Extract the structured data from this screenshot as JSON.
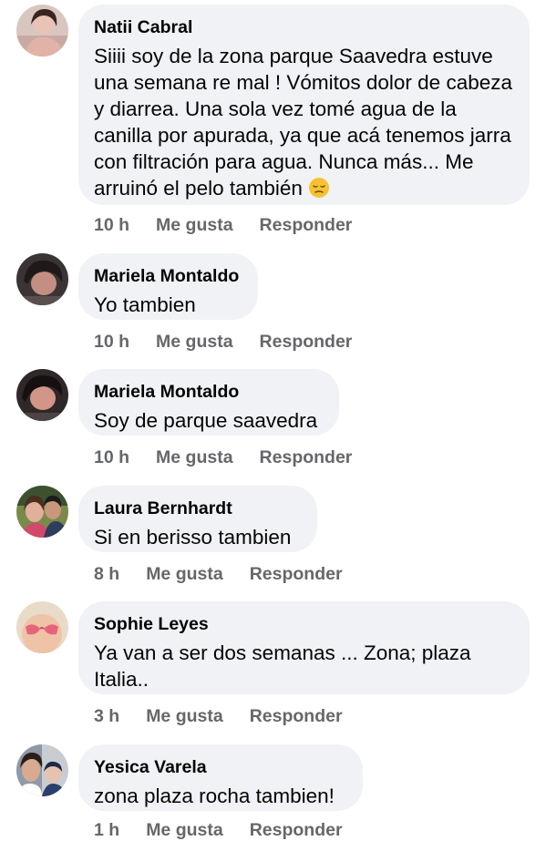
{
  "comments": [
    {
      "author": "Natii Cabral",
      "text": "Siiii soy de la zona parque Saavedra estuve una semana re mal ! Vómitos dolor de cabeza y diarrea. Una sola vez tomé agua de la canilla por apurada, ya que acá tenemos jarra con filtración para agua. Nunca más... Me arruinó el pelo también",
      "emoji": "pensive-face-emoji",
      "time": "10 h",
      "like": "Me gusta",
      "reply": "Responder"
    },
    {
      "author": "Mariela Montaldo",
      "text": "Yo tambien",
      "time": "10 h",
      "like": "Me gusta",
      "reply": "Responder"
    },
    {
      "author": "Mariela Montaldo",
      "text": "Soy de parque saavedra",
      "time": "10 h",
      "like": "Me gusta",
      "reply": "Responder"
    },
    {
      "author": "Laura Bernhardt",
      "text": "Si en berisso tambien",
      "time": "8 h",
      "like": "Me gusta",
      "reply": "Responder"
    },
    {
      "author": "Sophie Leyes",
      "text": "Ya van a ser dos semanas ... Zona; plaza Italia..",
      "time": "3 h",
      "like": "Me gusta",
      "reply": "Responder"
    },
    {
      "author": "Yesica Varela",
      "text": "zona plaza rocha tambien!",
      "time": "1 h",
      "like": "Me gusta",
      "reply": "Responder"
    }
  ],
  "colors": {
    "bubble": "#f0f2f5",
    "text": "#050505",
    "secondary": "#65676b"
  }
}
